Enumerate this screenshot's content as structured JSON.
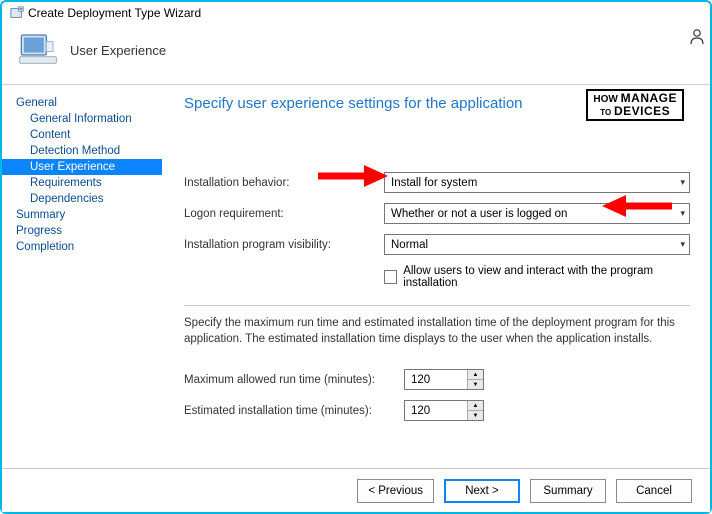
{
  "window": {
    "title": "Create Deployment Type Wizard"
  },
  "header": {
    "title": "User Experience"
  },
  "sidebar": {
    "items": [
      {
        "label": "General"
      },
      {
        "label": "General Information"
      },
      {
        "label": "Content"
      },
      {
        "label": "Detection Method"
      },
      {
        "label": "User Experience"
      },
      {
        "label": "Requirements"
      },
      {
        "label": "Dependencies"
      },
      {
        "label": "Summary"
      },
      {
        "label": "Progress"
      },
      {
        "label": "Completion"
      }
    ]
  },
  "main": {
    "heading": "Specify user experience settings for the application",
    "labels": {
      "install_behavior": "Installation behavior:",
      "logon_requirement": "Logon requirement:",
      "visibility": "Installation program visibility:",
      "allow_interact": "Allow users to view and interact with the program installation",
      "description": "Specify the maximum run time and estimated installation time of the deployment program for this application. The estimated installation time displays to the user when the application installs.",
      "max_runtime": "Maximum allowed run time (minutes):",
      "est_install": "Estimated installation time (minutes):"
    },
    "values": {
      "install_behavior": "Install for system",
      "logon_requirement": "Whether or not a user is logged on",
      "visibility": "Normal",
      "max_runtime": "120",
      "est_install": "120"
    }
  },
  "footer": {
    "previous": "< Previous",
    "next": "Next >",
    "summary": "Summary",
    "cancel": "Cancel"
  },
  "watermark": {
    "line1": "HOW",
    "line2": "MANAGE",
    "line3": "DEVICES",
    "to": "TO"
  }
}
